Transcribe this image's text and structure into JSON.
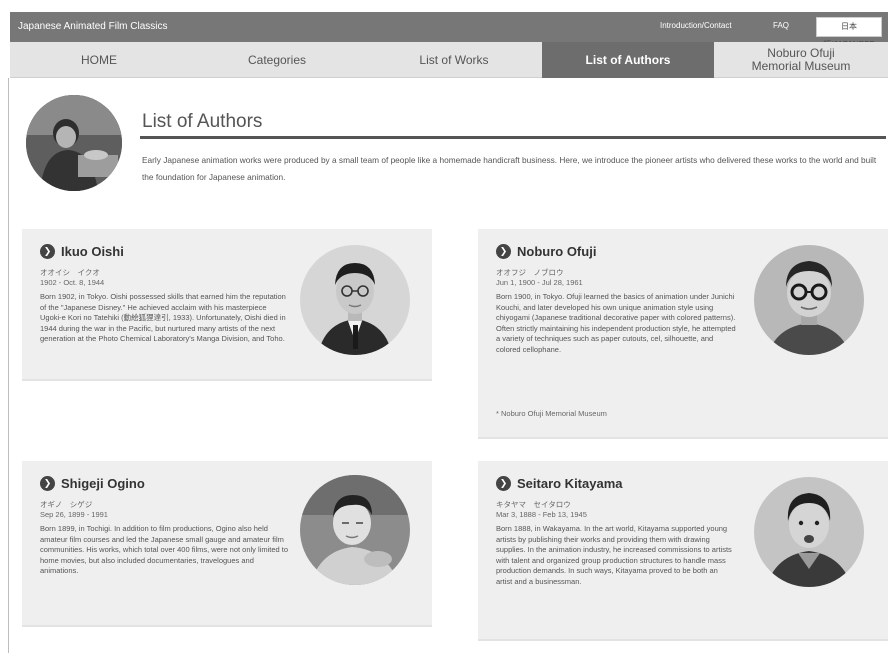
{
  "header": {
    "site_title": "Japanese Animated Film Classics",
    "links": [
      "Introduction/Contact",
      "FAQ"
    ],
    "language_button": "日本語/JAPANESE"
  },
  "nav": {
    "tabs": [
      {
        "label": "HOME"
      },
      {
        "label": "Categories"
      },
      {
        "label": "List of Works"
      },
      {
        "label": "List of Authors"
      },
      {
        "label": "Noburo Ofuji\nMemorial Museum"
      }
    ],
    "active_tab": "List of Authors"
  },
  "page": {
    "title": "List of Authors",
    "intro": "Early Japanese animation works were produced by a small team of people like a homemade handicraft business. Here, we introduce the pioneer artists who delivered these works to the world and built the foundation for Japanese animation."
  },
  "authors": [
    {
      "name": "Ikuo Oishi",
      "kana": "オオイシ　イクオ",
      "dates": "1902 - Oct. 8, 1944",
      "bio": "Born 1902, in Tokyo. Oishi possessed skills that earned him the reputation of the \"Japanese Disney.\" He achieved acclaim with his masterpiece Ugoki-e Kori no Tatehiki (動絵狐狸達引, 1933). Unfortunately, Oishi died in 1944 during the war in the Pacific, but nurtured many artists of the next generation at the Photo Chemical Laboratory's Manga Division, and Toho."
    },
    {
      "name": "Noburo Ofuji",
      "kana": "オオフジ　ノブロウ",
      "dates": "Jun 1, 1900 - Jul 28, 1961",
      "bio": "Born 1900, in Tokyo. Ofuji learned the basics of animation under Junichi Kouchi, and later developed his own unique animation style using chiyogami (Japanese traditional decorative paper with colored patterns). Often strictly maintaining his independent production style, he attempted a variety of techniques such as paper cutouts, cel, silhouette, and colored cellophane.",
      "credit": "* Noburo Ofuji Memorial Museum"
    },
    {
      "name": "Shigeji Ogino",
      "kana": "オギノ　シゲジ",
      "dates": "Sep 26, 1899 - 1991",
      "bio": "Born 1899, in Tochigi. In addition to film productions, Ogino also held amateur film courses and led the Japanese small gauge and amateur film communities. His works, which total over 400 films, were not only limited to home movies, but also included documentaries, travelogues and animations."
    },
    {
      "name": "Seitaro Kitayama",
      "kana": "キタヤマ　セイタロウ",
      "dates": "Mar 3, 1888 - Feb 13, 1945",
      "bio": "Born 1888, in Wakayama. In the art world, Kitayama supported young artists by publishing their works and providing them with drawing supplies. In the animation industry, he increased commissions to artists with talent and organized group production structures to handle mass production demands. In such ways, Kitayama proved to be both an artist and a businessman."
    }
  ]
}
